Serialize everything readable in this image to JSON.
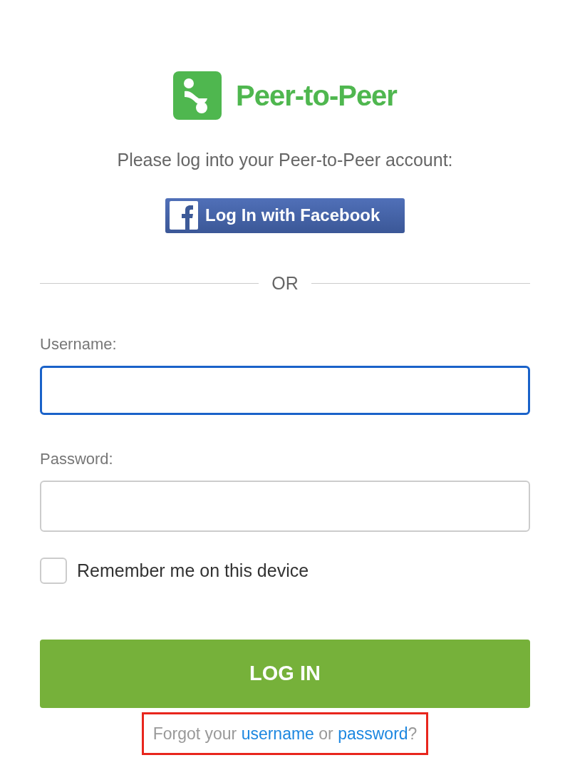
{
  "logo": {
    "text": "Peer-to-Peer"
  },
  "subtitle": "Please log into your Peer-to-Peer account:",
  "facebook_button": {
    "label": "Log In with Facebook"
  },
  "divider": "OR",
  "fields": [
    {
      "label": "Username:",
      "focused": true
    },
    {
      "label": "Password:",
      "focused": false
    }
  ],
  "remember": {
    "label": "Remember me on this device",
    "checked": false
  },
  "login_button": "LOG IN",
  "forgot": {
    "parts": [
      {
        "kind": "text",
        "text": "Forgot your "
      },
      {
        "kind": "link",
        "text": "username"
      },
      {
        "kind": "text",
        "text": " or "
      },
      {
        "kind": "link",
        "text": "password"
      },
      {
        "kind": "text",
        "text": "?"
      }
    ],
    "highlighted": true
  }
}
